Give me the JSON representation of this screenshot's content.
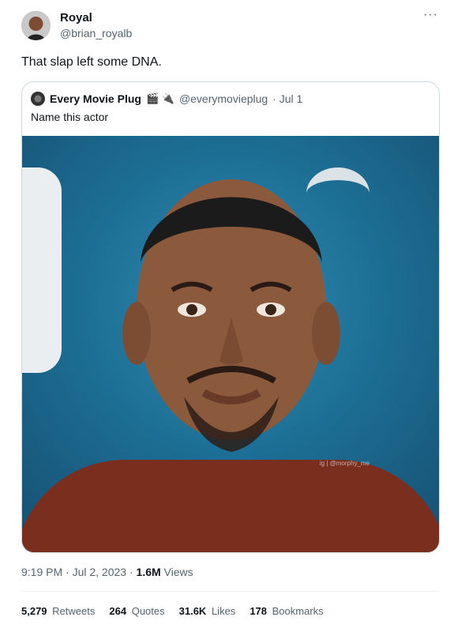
{
  "author": {
    "name": "Royal",
    "handle": "@brian_royalb"
  },
  "tweet_text": "That slap left some DNA.",
  "menu_icon": "more-dots",
  "quoted": {
    "name": "Every Movie Plug",
    "emoji": "🎬 🔌",
    "handle": "@everymovieplug",
    "date": "· Jul 1",
    "text": "Name this actor",
    "watermark": "ig | @morphy_me"
  },
  "meta": {
    "time_date": "9:19 PM · Jul 2, 2023 ·",
    "views_count": "1.6M",
    "views_label": "Views"
  },
  "stats": {
    "retweets_count": "5,279",
    "retweets_label": "Retweets",
    "quotes_count": "264",
    "quotes_label": "Quotes",
    "likes_count": "31.6K",
    "likes_label": "Likes",
    "bookmarks_count": "178",
    "bookmarks_label": "Bookmarks"
  }
}
